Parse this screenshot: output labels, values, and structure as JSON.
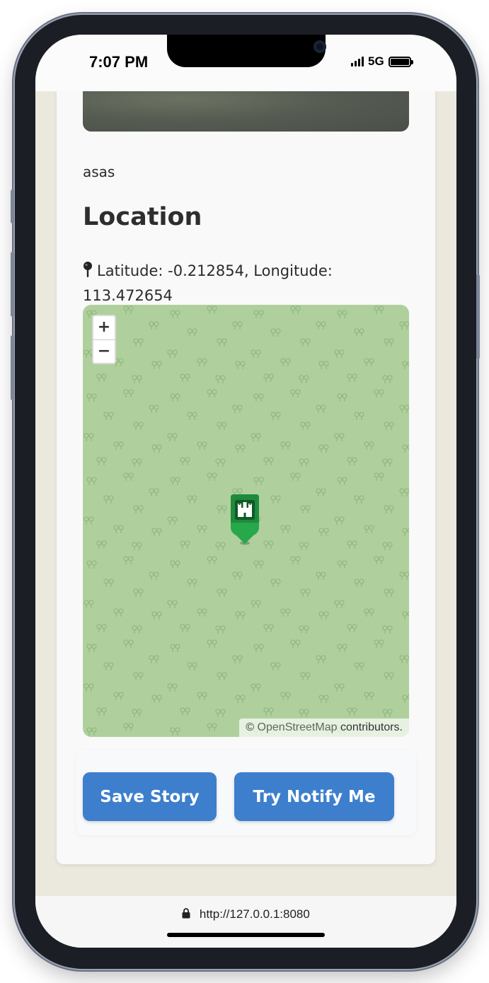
{
  "status_bar": {
    "time": "7:07 PM",
    "network": "5G"
  },
  "story": {
    "description": "asas"
  },
  "location": {
    "heading": "Location",
    "coordinates_text": "Latitude: -0.212854, Longitude: 113.472654",
    "latitude": -0.212854,
    "longitude": 113.472654
  },
  "map": {
    "zoom_in": "+",
    "zoom_out": "−",
    "attribution_prefix": "©",
    "attribution_link": "OpenStreetMap",
    "attribution_suffix": "contributors.",
    "marker_icon": "castle-icon",
    "background_color": "#afd09c"
  },
  "actions": {
    "save_label": "Save Story",
    "notify_label": "Try Notify Me",
    "button_color": "#3d7fcd"
  },
  "browser": {
    "url": "http://127.0.0.1:8080"
  }
}
